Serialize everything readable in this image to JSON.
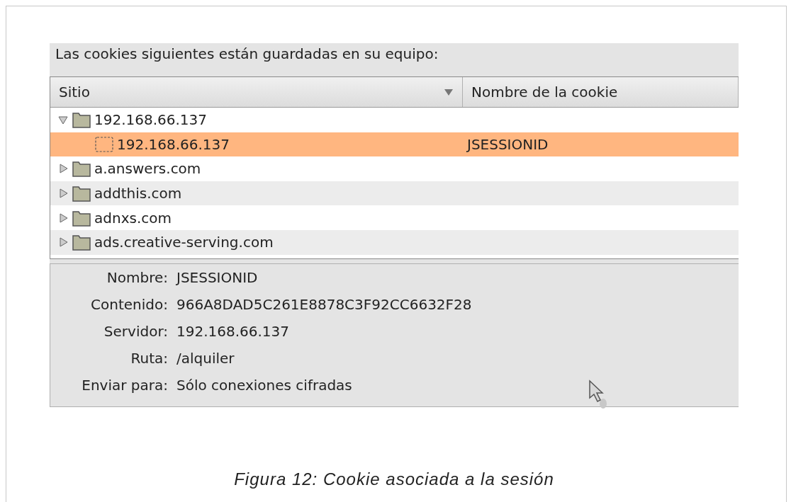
{
  "intro": "Las cookies siguientes están guardadas en su equipo:",
  "table": {
    "columns": [
      {
        "label": "Sitio",
        "sorted": true
      },
      {
        "label": "Nombre de la cookie",
        "sorted": false
      }
    ],
    "rows": [
      {
        "site": "192.168.66.137",
        "cookie": "",
        "kind": "folder",
        "expanded": true,
        "selected": false,
        "children": [
          {
            "site": "192.168.66.137",
            "cookie": "JSESSIONID",
            "kind": "cookie",
            "selected": true
          }
        ]
      },
      {
        "site": "a.answers.com",
        "cookie": "",
        "kind": "folder",
        "expanded": false,
        "selected": false
      },
      {
        "site": "addthis.com",
        "cookie": "",
        "kind": "folder",
        "expanded": false,
        "selected": false
      },
      {
        "site": "adnxs.com",
        "cookie": "",
        "kind": "folder",
        "expanded": false,
        "selected": false
      },
      {
        "site": "ads.creative-serving.com",
        "cookie": "",
        "kind": "folder",
        "expanded": false,
        "selected": false
      }
    ]
  },
  "details": [
    {
      "label": "Nombre:",
      "value": "JSESSIONID"
    },
    {
      "label": "Contenido:",
      "value": "966A8DAD5C261E8878C3F92CC6632F28"
    },
    {
      "label": "Servidor:",
      "value": "192.168.66.137"
    },
    {
      "label": "Ruta:",
      "value": "/alquiler"
    },
    {
      "label": "Enviar para:",
      "value": "Sólo conexiones cifradas"
    }
  ],
  "caption": "Figura 12: Cookie asociada a la sesión"
}
